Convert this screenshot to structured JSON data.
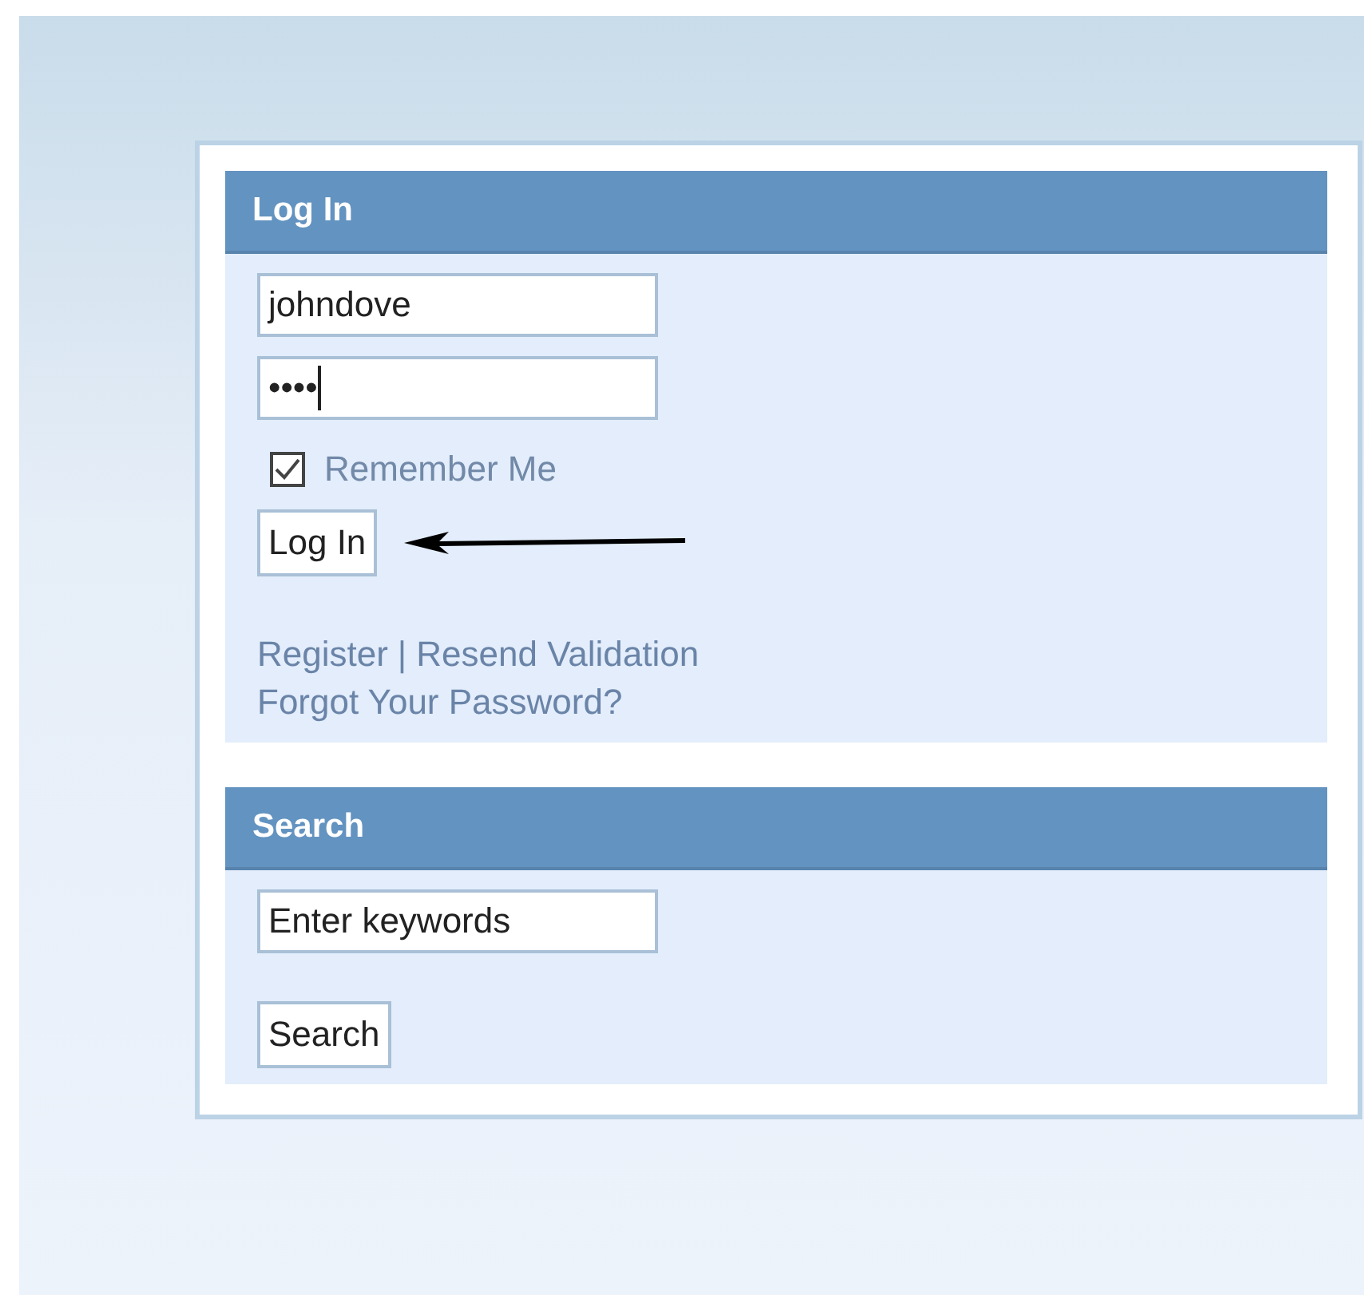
{
  "login": {
    "title": "Log In",
    "username": {
      "value": "johndove"
    },
    "password": {
      "value": "••••",
      "focused": true
    },
    "remember": {
      "label": "Remember Me",
      "checked": true
    },
    "button": "Log In",
    "links": [
      {
        "kind": "link",
        "text": "Register"
      },
      {
        "kind": "separator",
        "text": "|"
      },
      {
        "kind": "link",
        "text": "Resend Validation"
      },
      {
        "kind": "break"
      },
      {
        "kind": "link",
        "text": "Forgot Your Password?"
      }
    ]
  },
  "search": {
    "title": "Search",
    "field": {
      "value": "Enter keywords"
    },
    "button": "Search"
  }
}
